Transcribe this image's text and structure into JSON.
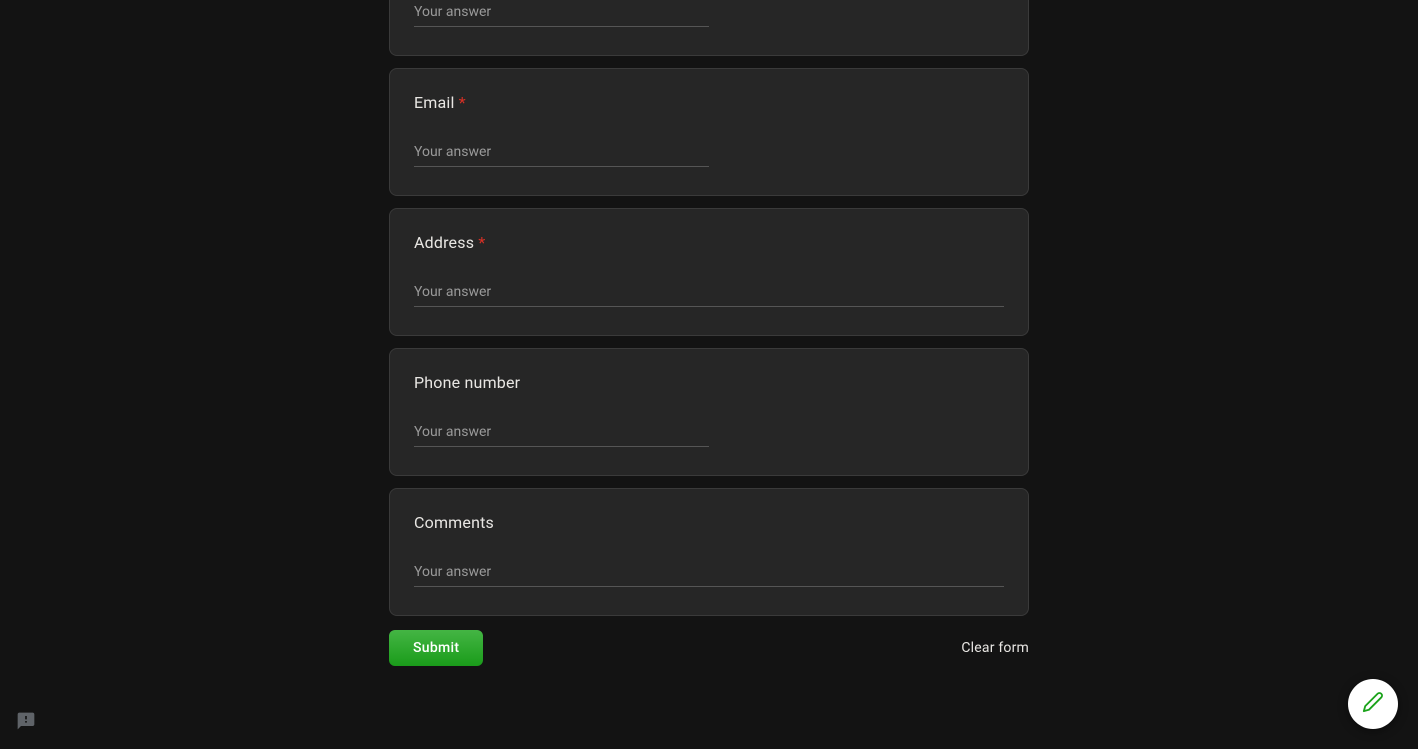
{
  "questions": {
    "q0": {
      "placeholder": "Your answer"
    },
    "q1": {
      "label": "Email",
      "required": "*",
      "placeholder": "Your answer"
    },
    "q2": {
      "label": "Address",
      "required": "*",
      "placeholder": "Your answer"
    },
    "q3": {
      "label": "Phone number",
      "placeholder": "Your answer"
    },
    "q4": {
      "label": "Comments",
      "placeholder": "Your answer"
    }
  },
  "actions": {
    "submit": "Submit",
    "clear": "Clear form"
  }
}
